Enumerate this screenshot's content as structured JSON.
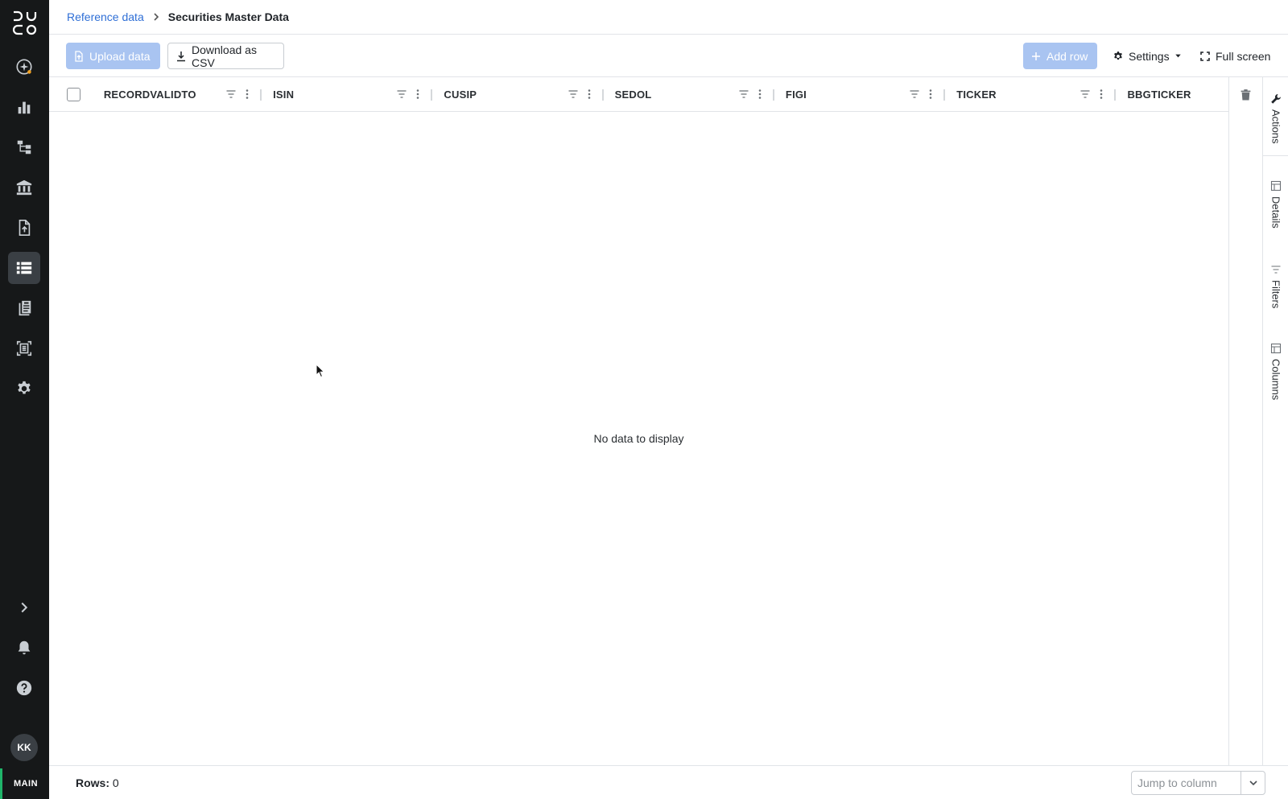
{
  "app": {
    "logo_letters": "DUCO",
    "user_initials": "KK",
    "environment": "MAIN"
  },
  "nav": {
    "items": [
      {
        "name": "ai-assistant",
        "icon": "sparkle-icon",
        "active": false
      },
      {
        "name": "dashboards",
        "icon": "bar-chart-icon",
        "active": false
      },
      {
        "name": "processes",
        "icon": "hierarchy-icon",
        "active": false
      },
      {
        "name": "institutions",
        "icon": "bank-icon",
        "active": false
      },
      {
        "name": "file-upload",
        "icon": "file-upload-icon",
        "active": false
      },
      {
        "name": "reference-data",
        "icon": "list-icon",
        "active": true
      },
      {
        "name": "reports",
        "icon": "clipboard-icon",
        "active": false
      },
      {
        "name": "scanner",
        "icon": "scan-document-icon",
        "active": false
      },
      {
        "name": "settings",
        "icon": "gear-icon",
        "active": false
      }
    ],
    "bottom": [
      "chevron-right-icon",
      "bell-icon",
      "help-icon"
    ]
  },
  "breadcrumb": {
    "parent": "Reference data",
    "current": "Securities Master Data"
  },
  "toolbar": {
    "upload_label": "Upload data",
    "download_label": "Download as CSV",
    "add_row_label": "Add row",
    "settings_label": "Settings",
    "full_screen_label": "Full screen"
  },
  "grid": {
    "columns": [
      "RECORDVALIDTO",
      "ISIN",
      "CUSIP",
      "SEDOL",
      "FIGI",
      "TICKER",
      "BBGTICKER"
    ],
    "empty_message": "No data to display"
  },
  "side_panel": {
    "tabs": [
      "Actions",
      "Details",
      "Filters",
      "Columns"
    ]
  },
  "footer": {
    "rows_label": "Rows:",
    "rows_value": "0",
    "jump_placeholder": "Jump to column"
  },
  "colors": {
    "rail_bg": "#161819",
    "accent": "#2f6fd6",
    "disabled_button": "#a9c4f1",
    "env_indicator": "#1fb56a"
  }
}
